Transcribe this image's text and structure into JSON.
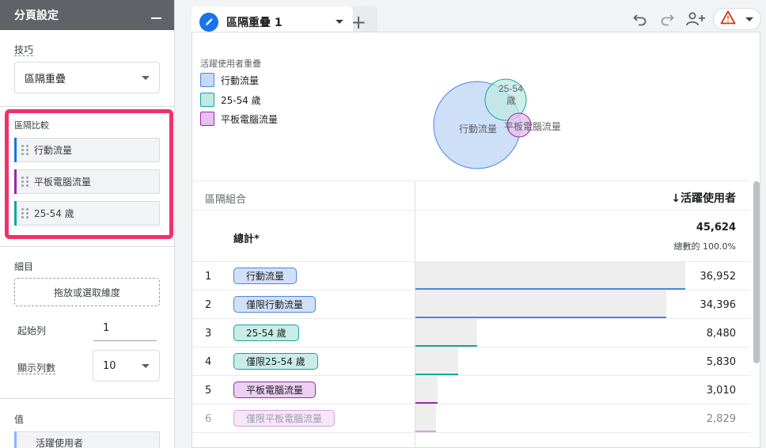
{
  "left_panel": {
    "title": "分頁設定",
    "technique_label": "技巧",
    "technique_value": "區隔重疊",
    "segment_compare_label": "區隔比較",
    "segments": [
      {
        "label": "行動流量",
        "color": "#1a73e8"
      },
      {
        "label": "平板電腦流量",
        "color": "#9c27b0"
      },
      {
        "label": "25-54 歲",
        "color": "#12a5a0"
      }
    ],
    "breakdown_label": "細目",
    "breakdown_drop": "拖放或選取維度",
    "start_row_label": "起始列",
    "start_row_value": "1",
    "show_rows_label": "顯示列數",
    "show_rows_value": "10",
    "values_label": "值",
    "value_chip": "活躍使用者"
  },
  "tabs": {
    "active_tab": "區隔重疊 1",
    "add_tab": "+"
  },
  "toolbar": {
    "undo_icon": "undo-icon",
    "redo_icon": "redo-icon",
    "share_icon": "add-person-icon",
    "warning_icon": "warning-icon"
  },
  "venn": {
    "title": "活躍使用者重疊",
    "legend": [
      {
        "label": "行動流量",
        "fill": "#c6d9f7",
        "stroke": "#4a86e8"
      },
      {
        "label": "25-54 歲",
        "fill": "#bfe8e2",
        "stroke": "#12a5a0"
      },
      {
        "label": "平板電腦流量",
        "fill": "#e7c1ef",
        "stroke": "#9c27b0"
      }
    ],
    "circle_labels": {
      "mobile": "行動流量",
      "age_line1": "25-54",
      "age_line2": "歲",
      "tablet": "平板電腦流量"
    }
  },
  "table": {
    "col_segment": "區隔組合",
    "col_metric": "↓活躍使用者",
    "total_label": "總計*",
    "total_value": "45,624",
    "total_pct": "總數的 100.0%",
    "rows": [
      {
        "num": "1",
        "label": "行動流量",
        "value": "36,952",
        "fraction": 0.81,
        "color": "#4a86e8",
        "fill": "#d2e0f7",
        "border": "#4a86e8"
      },
      {
        "num": "2",
        "label": "僅限行動流量",
        "value": "34,396",
        "fraction": 0.754,
        "color": "#4a86e8",
        "fill": "#d2e0f7",
        "border": "#4a86e8"
      },
      {
        "num": "3",
        "label": "25-54 歲",
        "value": "8,480",
        "fraction": 0.186,
        "color": "#12a5a0",
        "fill": "#c9ece6",
        "border": "#12a5a0"
      },
      {
        "num": "4",
        "label": "僅限25-54 歲",
        "value": "5,830",
        "fraction": 0.128,
        "color": "#12a5a0",
        "fill": "#c9ece6",
        "border": "#12a5a0"
      },
      {
        "num": "5",
        "label": "平板電腦流量",
        "value": "3,010",
        "fraction": 0.066,
        "color": "#9c27b0",
        "fill": "#ecd0f1",
        "border": "#9c27b0"
      },
      {
        "num": "6",
        "label": "僅限平板電腦流量",
        "value": "2,829",
        "fraction": 0.062,
        "color": "#d7a2df",
        "fill": "#f6e6f8",
        "border": "#d7a2df"
      }
    ]
  }
}
